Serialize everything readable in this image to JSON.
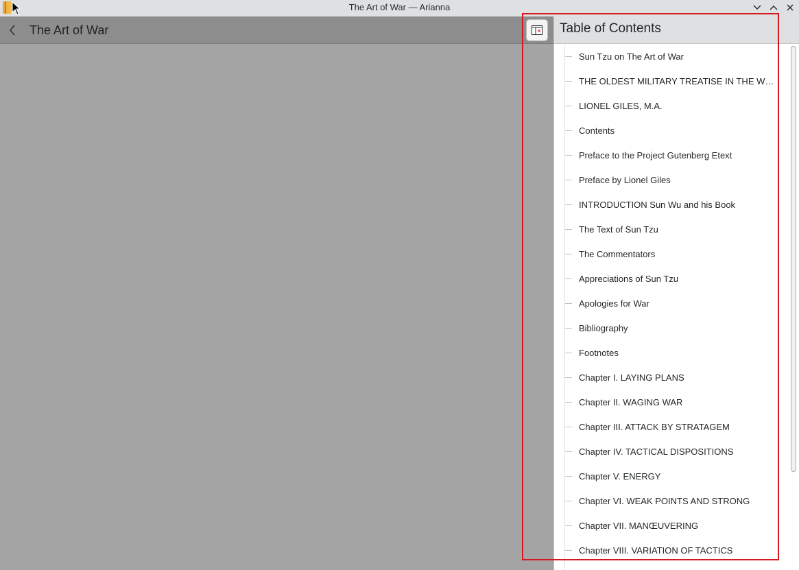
{
  "window": {
    "title": "The Art of War — Arianna"
  },
  "toolbar": {
    "page_title": "The Art of War"
  },
  "drawer": {
    "title": "Table of Contents"
  },
  "toc": {
    "items": [
      {
        "label": "Sun Tzu on The Art of War"
      },
      {
        "label": "THE OLDEST MILITARY TREATISE IN THE WOR..."
      },
      {
        "label": "LIONEL GILES, M.A."
      },
      {
        "label": "Contents"
      },
      {
        "label": "Preface to the Project Gutenberg Etext"
      },
      {
        "label": "Preface by Lionel Giles"
      },
      {
        "label": "INTRODUCTION Sun Wu and his Book"
      },
      {
        "label": "The Text of Sun Tzu"
      },
      {
        "label": "The Commentators"
      },
      {
        "label": "Appreciations of Sun Tzu"
      },
      {
        "label": "Apologies for War"
      },
      {
        "label": "Bibliography"
      },
      {
        "label": "Footnotes"
      },
      {
        "label": "Chapter I. LAYING PLANS"
      },
      {
        "label": "Chapter II. WAGING WAR"
      },
      {
        "label": "Chapter III. ATTACK BY STRATAGEM"
      },
      {
        "label": "Chapter IV. TACTICAL DISPOSITIONS"
      },
      {
        "label": "Chapter V. ENERGY"
      },
      {
        "label": "Chapter VI. WEAK POINTS AND STRONG"
      },
      {
        "label": "Chapter VII. MANŒUVERING"
      },
      {
        "label": "Chapter VIII. VARIATION OF TACTICS"
      }
    ]
  },
  "colors": {
    "highlight": "#d9161e",
    "reader_background": "#a4a4a4",
    "titlebar": "#dee0e2"
  }
}
